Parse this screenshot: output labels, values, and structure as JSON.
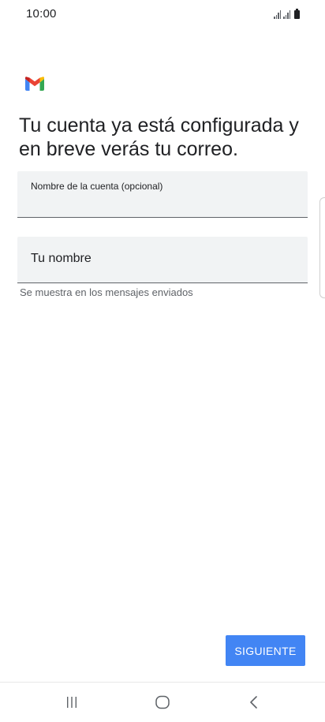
{
  "status_bar": {
    "time": "10:00"
  },
  "app": {
    "logo_icon": "gmail-logo-icon"
  },
  "heading": "Tu cuenta ya está configurada y en breve verás tu correo.",
  "form": {
    "account_name": {
      "label": "Nombre de la cuenta (opcional)",
      "value": ""
    },
    "your_name": {
      "label": "Tu nombre",
      "value": "",
      "helper": "Se muestra en los mensajes enviados"
    }
  },
  "buttons": {
    "next_label": "SIGUIENTE"
  },
  "nav_bar": {
    "recent_icon": "recent-apps-icon",
    "home_icon": "home-icon",
    "back_icon": "back-icon"
  },
  "colors": {
    "accent": "#4285f4",
    "field_bg": "#f1f3f4",
    "text": "#202124",
    "secondary_text": "#5f6368"
  }
}
